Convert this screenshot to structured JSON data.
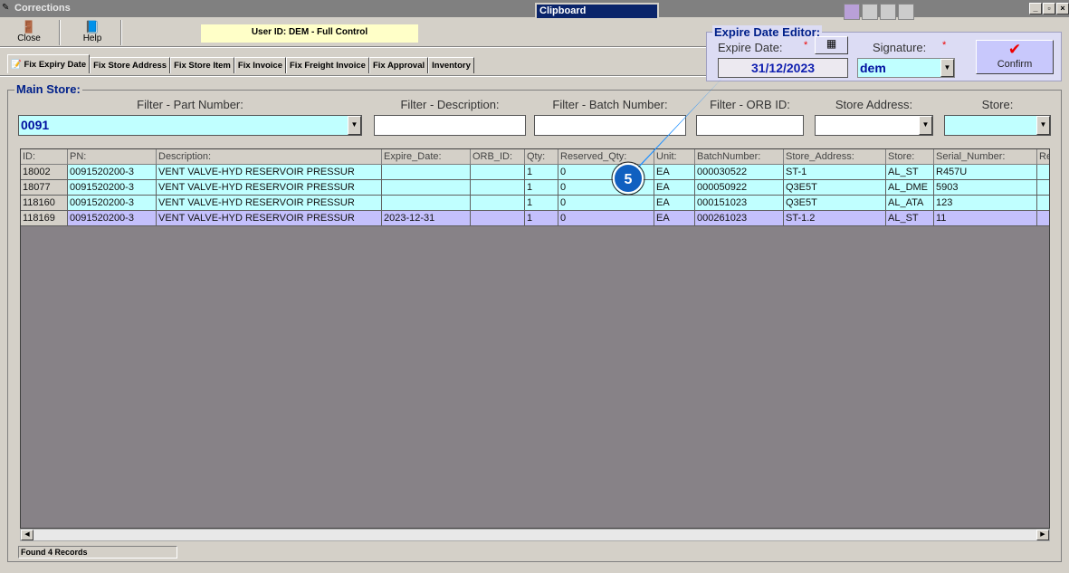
{
  "window": {
    "title": "Corrections",
    "clipboard": "Clipboard"
  },
  "toolbar": {
    "close": "Close",
    "help": "Help",
    "user": "User ID: DEM - Full Control"
  },
  "tabs": [
    "Fix Expiry Date",
    "Fix Store Address",
    "Fix Store Item",
    "Fix Invoice",
    "Fix Freight Invoice",
    "Fix Approval",
    "Inventory"
  ],
  "editor": {
    "title": "Expire Date Editor:",
    "date_label": "Expire Date:",
    "date_value": "31/12/2023",
    "sig_label": "Signature:",
    "sig_value": "dem",
    "confirm": "Confirm",
    "required": "*"
  },
  "main": {
    "title": "Main Store:"
  },
  "filters": [
    {
      "label": "Filter - Part Number:",
      "value": "0091"
    },
    {
      "label": "Filter - Description:",
      "value": ""
    },
    {
      "label": "Filter - Batch Number:",
      "value": ""
    },
    {
      "label": "Filter - ORB ID:",
      "value": ""
    },
    {
      "label": "Store Address:",
      "value": ""
    },
    {
      "label": "Store:",
      "value": ""
    }
  ],
  "columns": [
    "ID:",
    "PN:",
    "Description:",
    "Expire_Date:",
    "ORB_ID:",
    "Qty:",
    "Reserved_Qty:",
    "Unit:",
    "BatchNumber:",
    "Store_Address:",
    "Store:",
    "Serial_Number:",
    "Re"
  ],
  "rows": [
    [
      "18002",
      "0091520200-3",
      "VENT VALVE-HYD RESERVOIR PRESSUR",
      "",
      "",
      "1",
      "0",
      "EA",
      "000030522",
      "ST-1",
      "AL_ST",
      "R457U",
      ""
    ],
    [
      "18077",
      "0091520200-3",
      "VENT VALVE-HYD RESERVOIR PRESSUR",
      "",
      "",
      "1",
      "0",
      "EA",
      "000050922",
      "Q3E5T",
      "AL_DME",
      "5903",
      ""
    ],
    [
      "118160",
      "0091520200-3",
      "VENT VALVE-HYD RESERVOIR PRESSUR",
      "",
      "",
      "1",
      "0",
      "EA",
      "000151023",
      "Q3E5T",
      "AL_ATA",
      "123",
      ""
    ],
    [
      "118169",
      "0091520200-3",
      "VENT VALVE-HYD RESERVOIR PRESSUR",
      "2023-12-31",
      "",
      "1",
      "0",
      "EA",
      "000261023",
      "ST-1.2",
      "AL_ST",
      "11",
      ""
    ]
  ],
  "selected_row": 3,
  "status": "Found 4 Records",
  "callout": {
    "number": "5",
    "color": "#1e90ff"
  }
}
